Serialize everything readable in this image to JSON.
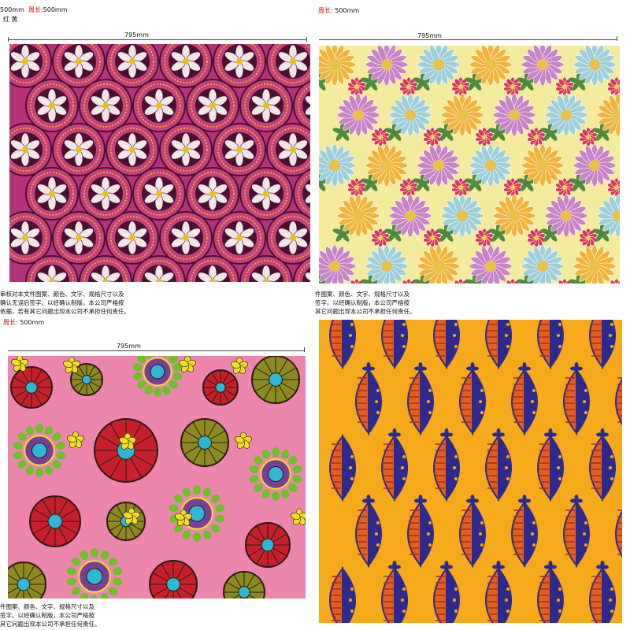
{
  "panels": {
    "tl": {
      "header_line1_prefix": "500mm",
      "header_line1_label": "周长:",
      "header_line1_value": "500mm",
      "header_line2": "红 黄",
      "width_label": "795mm",
      "note_lines": [
        "审核对本文件图案、颜色、文字、规格尺寸以及",
        "确认无误后签字。以经确认制版，本公司严格按",
        "依据，若有其它问题出现本公司不承担任何责任。"
      ],
      "palette": {
        "bg": "#b2337a",
        "ring": "#c7417f",
        "petal": "#efe6e8",
        "center": "#e8c21a",
        "dark": "#4a1030"
      }
    },
    "tr": {
      "header_label": "周长:",
      "header_value": "500mm",
      "width_label": "795mm",
      "note_lines": [
        "件图案、颜色、文字、规格尺寸以及",
        "签字。以经确认制版，本公司严格按",
        "其它问题出现本公司不承担任何责任。"
      ],
      "palette": {
        "bg": "#f4ec9c",
        "orange": "#f0b43b",
        "purple": "#c784c9",
        "blue": "#9ed0dc",
        "red": "#d43a55",
        "leaf": "#4d8a3d"
      }
    },
    "bl": {
      "header_label": "周长:",
      "header_value": "500mm",
      "width_label": "795mm",
      "note_lines": [
        "件图案、颜色、文字、规格尺寸以及",
        "签字。以经确认制版，本公司严格按",
        "其它问题出现本公司不承担任何责任。"
      ],
      "palette": {
        "bg": "#ec86ad",
        "red": "#c8202a",
        "olive": "#8a8a1e",
        "purple": "#7a3d98",
        "cyan": "#2fb6d5",
        "yellow": "#f0e025",
        "green": "#6fbf2a"
      }
    },
    "br": {
      "palette": {
        "bg": "#f6a91b",
        "navy": "#2c2a8c",
        "orange": "#e0601e",
        "red": "#b3261e"
      }
    }
  }
}
